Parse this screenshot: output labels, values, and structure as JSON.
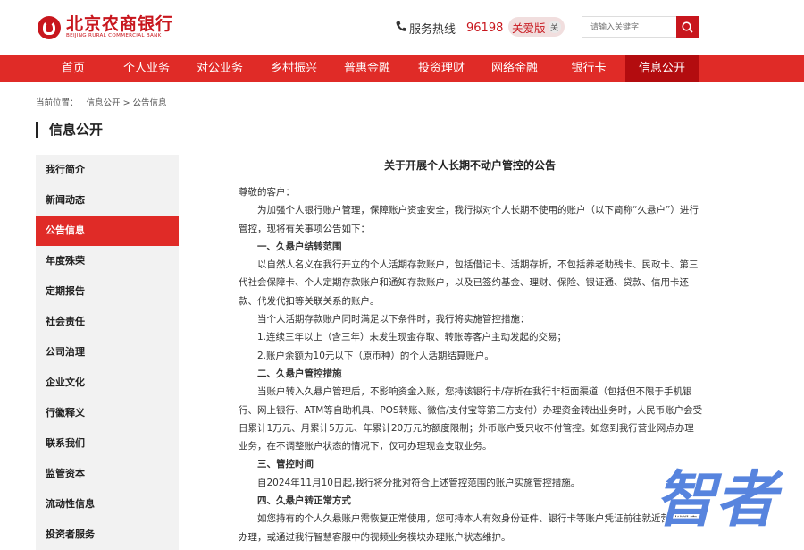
{
  "header": {
    "logo_cn": "北京农商银行",
    "logo_en": "BEIJING RURAL COMMERCIAL BANK",
    "hotline_label": "服务热线",
    "hotline_number": "96198",
    "care_mode_label": "关爱版",
    "care_close": "关",
    "search_placeholder": "请输入关键字"
  },
  "nav": [
    {
      "label": "首页"
    },
    {
      "label": "个人业务"
    },
    {
      "label": "对公业务"
    },
    {
      "label": "乡村振兴"
    },
    {
      "label": "普惠金融"
    },
    {
      "label": "投资理财"
    },
    {
      "label": "网络金融"
    },
    {
      "label": "银行卡"
    },
    {
      "label": "信息公开"
    }
  ],
  "breadcrumb": {
    "prefix": "当前位置：",
    "path": "信息公开 > 公告信息"
  },
  "sidebar": {
    "title": "信息公开",
    "items": [
      {
        "label": "我行简介"
      },
      {
        "label": "新闻动态"
      },
      {
        "label": "公告信息"
      },
      {
        "label": "年度殊荣"
      },
      {
        "label": "定期报告"
      },
      {
        "label": "社会责任"
      },
      {
        "label": "公司治理"
      },
      {
        "label": "企业文化"
      },
      {
        "label": "行徽释义"
      },
      {
        "label": "联系我们"
      },
      {
        "label": "监管资本"
      },
      {
        "label": "流动性信息"
      },
      {
        "label": "投资者服务"
      }
    ]
  },
  "article": {
    "title": "关于开展个人长期不动户管控的公告",
    "greeting": "尊敬的客户：",
    "p1": "为加强个人银行账户管理，保障账户资金安全，我行拟对个人长期不使用的账户（以下简称“久悬户”）进行管控，现将有关事项公告如下：",
    "h1": "一、久悬户结转范围",
    "p2": "以自然人名义在我行开立的个人活期存款账户，包括借记卡、活期存折，不包括养老助残卡、民政卡、第三代社会保障卡、个人定期存款账户和通知存款账户，以及已签约基金、理财、保险、银证通、贷款、信用卡还款、代发代扣等关联关系的账户。",
    "p3": "当个人活期存款账户同时满足以下条件时，我行将实施管控措施：",
    "p4": "1.连续三年以上（含三年）未发生现金存取、转账等客户主动发起的交易；",
    "p5": "2.账户余额为10元以下（原币种）的个人活期结算账户。",
    "h2": "二、久悬户管控措施",
    "p6": "当账户转入久悬户管理后，不影响资金入账，您持该银行卡/存折在我行非柜面渠道（包括但不限于手机银行、网上银行、ATM等自助机具、POS转账、微信/支付宝等第三方支付）办理资金转出业务时，人民币账户会受日累计1万元、月累计5万元、年累计20万元的额度限制；外币账户受只收不付管控。如您到我行营业网点办理业务，在不调整账户状态的情况下，仅可办理现金支取业务。",
    "h3": "三、管控时间",
    "p7": "自2024年11月10日起,我行将分批对符合上述管控范围的账户实施管控措施。",
    "h4": "四、久悬户转正常方式",
    "p8": "如您持有的个人久悬账户需恢复正常使用，您可持本人有效身份证件、银行卡等账户凭证前往就近营业网点办理，或通过我行智慧客服中的视频业务模块办理账户状态维护。"
  },
  "watermark": {
    "text": "智者"
  },
  "colors": {
    "brand_red": "#e02b27",
    "active_nav": "#b30c0f",
    "logo_red": "#c8161d"
  }
}
